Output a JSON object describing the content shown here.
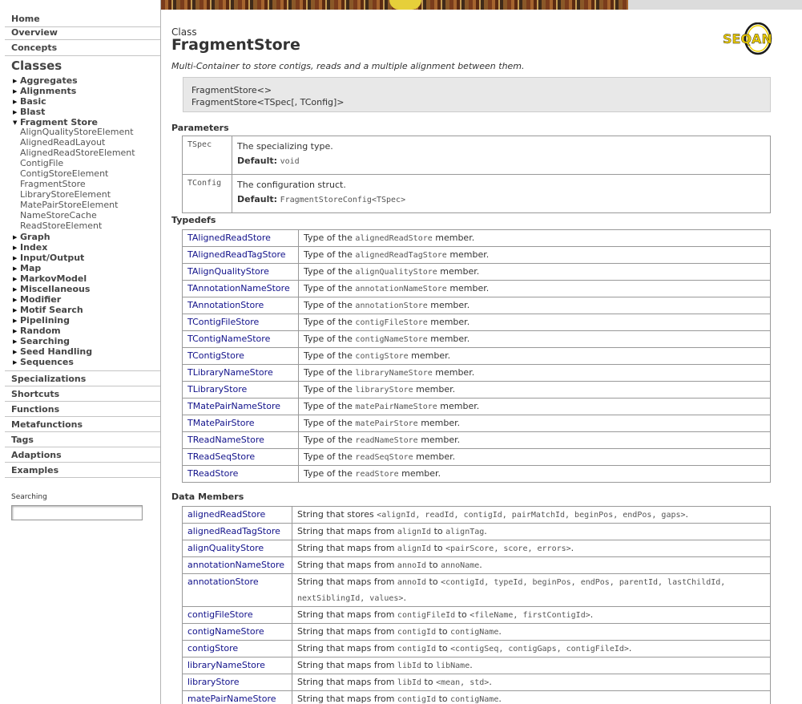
{
  "nav": {
    "home": "Home",
    "overview": "Overview",
    "concepts": "Concepts",
    "classes_heading": "Classes",
    "categories_before": [
      "Aggregates",
      "Alignments",
      "Basic",
      "Blast"
    ],
    "expanded": "Fragment Store",
    "fragment_store_items": [
      "AlignQualityStoreElement",
      "AlignedReadLayout",
      "AlignedReadStoreElement",
      "ContigFile",
      "ContigStoreElement",
      "FragmentStore",
      "LibraryStoreElement",
      "MatePairStoreElement",
      "NameStoreCache",
      "ReadStoreElement"
    ],
    "categories_after": [
      "Graph",
      "Index",
      "Input/Output",
      "Map",
      "MarkovModel",
      "Miscellaneous",
      "Modifier",
      "Motif Search",
      "Pipelining",
      "Random",
      "Searching",
      "Seed Handling",
      "Sequences"
    ],
    "sections": [
      "Specializations",
      "Shortcuts",
      "Functions",
      "Metafunctions",
      "Tags",
      "Adaptions",
      "Examples"
    ],
    "search_label": "Searching"
  },
  "page": {
    "kind": "Class",
    "title": "FragmentStore",
    "description": "Multi-Container to store contigs, reads and a multiple alignment between them.",
    "signature": [
      "FragmentStore<>",
      "FragmentStore<TSpec[, TConfig]>"
    ],
    "logo_text": "SEQAN"
  },
  "params_heading": "Parameters",
  "params": [
    {
      "name": "TSpec",
      "desc": "The specializing type.",
      "default_label": "Default:",
      "default": "void"
    },
    {
      "name": "TConfig",
      "desc": "The configuration struct.",
      "default_label": "Default:",
      "default": "FragmentStoreConfig<TSpec>"
    }
  ],
  "typedefs_heading": "Typedefs",
  "typedefs": [
    {
      "name": "TAlignedReadStore",
      "pre": "Type of the",
      "code": "alignedReadStore",
      "post": "member."
    },
    {
      "name": "TAlignedReadTagStore",
      "pre": "Type of the",
      "code": "alignedReadTagStore",
      "post": "member."
    },
    {
      "name": "TAlignQualityStore",
      "pre": "Type of the",
      "code": "alignQualityStore",
      "post": "member."
    },
    {
      "name": "TAnnotationNameStore",
      "pre": "Type of the",
      "code": "annotationNameStore",
      "post": "member."
    },
    {
      "name": "TAnnotationStore",
      "pre": "Type of the",
      "code": "annotationStore",
      "post": "member."
    },
    {
      "name": "TContigFileStore",
      "pre": "Type of the",
      "code": "contigFileStore",
      "post": "member."
    },
    {
      "name": "TContigNameStore",
      "pre": "Type of the",
      "code": "contigNameStore",
      "post": "member."
    },
    {
      "name": "TContigStore",
      "pre": "Type of the",
      "code": "contigStore",
      "post": "member."
    },
    {
      "name": "TLibraryNameStore",
      "pre": "Type of the",
      "code": "libraryNameStore",
      "post": "member."
    },
    {
      "name": "TLibraryStore",
      "pre": "Type of the",
      "code": "libraryStore",
      "post": "member."
    },
    {
      "name": "TMatePairNameStore",
      "pre": "Type of the",
      "code": "matePairNameStore",
      "post": "member."
    },
    {
      "name": "TMatePairStore",
      "pre": "Type of the",
      "code": "matePairStore",
      "post": "member."
    },
    {
      "name": "TReadNameStore",
      "pre": "Type of the",
      "code": "readNameStore",
      "post": "member."
    },
    {
      "name": "TReadSeqStore",
      "pre": "Type of the",
      "code": "readSeqStore",
      "post": "member."
    },
    {
      "name": "TReadStore",
      "pre": "Type of the",
      "code": "readStore",
      "post": "member."
    }
  ],
  "members_heading": "Data Members",
  "members": [
    {
      "name": "alignedReadStore",
      "parts": [
        [
          "t",
          "String that stores "
        ],
        [
          "c",
          "<alignId, readId, contigId, pairMatchId, beginPos, endPos, gaps>"
        ],
        [
          "t",
          "."
        ]
      ]
    },
    {
      "name": "alignedReadTagStore",
      "parts": [
        [
          "t",
          "String that maps from "
        ],
        [
          "c",
          "alignId"
        ],
        [
          "t",
          " to "
        ],
        [
          "c",
          "alignTag"
        ],
        [
          "t",
          "."
        ]
      ]
    },
    {
      "name": "alignQualityStore",
      "parts": [
        [
          "t",
          "String that maps from "
        ],
        [
          "c",
          "alignId"
        ],
        [
          "t",
          " to "
        ],
        [
          "c",
          "<pairScore, score, errors>"
        ],
        [
          "t",
          "."
        ]
      ]
    },
    {
      "name": "annotationNameStore",
      "parts": [
        [
          "t",
          "String that maps from "
        ],
        [
          "c",
          "annoId"
        ],
        [
          "t",
          " to "
        ],
        [
          "c",
          "annoName"
        ],
        [
          "t",
          "."
        ]
      ]
    },
    {
      "name": "annotationStore",
      "parts": [
        [
          "t",
          "String that maps from "
        ],
        [
          "c",
          "annoId"
        ],
        [
          "t",
          " to "
        ],
        [
          "c",
          "<contigId, typeId, beginPos, endPos, parentId, lastChildId, nextSiblingId, values>"
        ],
        [
          "t",
          "."
        ]
      ]
    },
    {
      "name": "contigFileStore",
      "parts": [
        [
          "t",
          "String that maps from "
        ],
        [
          "c",
          "contigFileId"
        ],
        [
          "t",
          " to "
        ],
        [
          "c",
          "<fileName, firstContigId>"
        ],
        [
          "t",
          "."
        ]
      ]
    },
    {
      "name": "contigNameStore",
      "parts": [
        [
          "t",
          "String that maps from "
        ],
        [
          "c",
          "contigId"
        ],
        [
          "t",
          " to "
        ],
        [
          "c",
          "contigName"
        ],
        [
          "t",
          "."
        ]
      ]
    },
    {
      "name": "contigStore",
      "parts": [
        [
          "t",
          "String that maps from "
        ],
        [
          "c",
          "contigId"
        ],
        [
          "t",
          " to "
        ],
        [
          "c",
          "<contigSeq, contigGaps, contigFileId>"
        ],
        [
          "t",
          "."
        ]
      ]
    },
    {
      "name": "libraryNameStore",
      "parts": [
        [
          "t",
          "String that maps from "
        ],
        [
          "c",
          "libId"
        ],
        [
          "t",
          " to "
        ],
        [
          "c",
          "libName"
        ],
        [
          "t",
          "."
        ]
      ]
    },
    {
      "name": "libraryStore",
      "parts": [
        [
          "t",
          "String that maps from "
        ],
        [
          "c",
          "libId"
        ],
        [
          "t",
          " to "
        ],
        [
          "c",
          "<mean, std>"
        ],
        [
          "t",
          "."
        ]
      ]
    },
    {
      "name": "matePairNameStore",
      "parts": [
        [
          "t",
          "String that maps from "
        ],
        [
          "c",
          "contigId"
        ],
        [
          "t",
          " to "
        ],
        [
          "c",
          "contigName"
        ],
        [
          "t",
          "."
        ]
      ]
    }
  ]
}
